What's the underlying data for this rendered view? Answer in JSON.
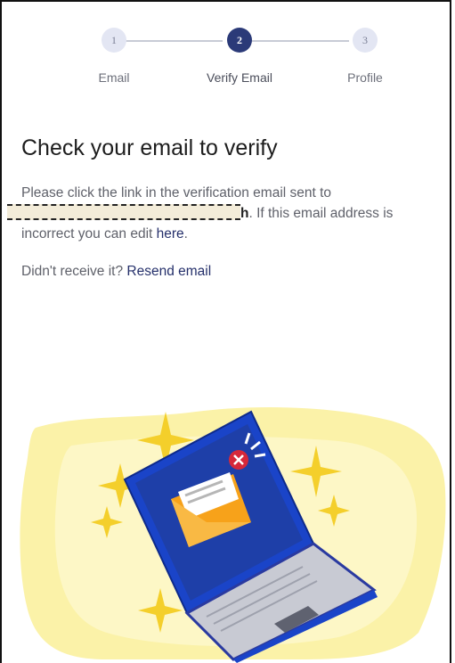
{
  "stepper": {
    "steps": [
      {
        "number": "1",
        "label": "Email",
        "state": "pending"
      },
      {
        "number": "2",
        "label": "Verify Email",
        "state": "active"
      },
      {
        "number": "3",
        "label": "Profile",
        "state": "pending"
      }
    ]
  },
  "main": {
    "title": "Check your email to verify",
    "message_intro": "Please click the link in the verification email sent to",
    "email_tail": "h",
    "message_mid": ". If this email address is incorrect you can edit ",
    "edit_link": "here",
    "message_end": ".",
    "resend_prompt": "Didn't receive it? ",
    "resend_link": "Resend email"
  },
  "colors": {
    "accent": "#2b3a78",
    "link": "#25306b",
    "illustration_bg": "#fbf2a8",
    "laptop": "#1a44c8"
  }
}
